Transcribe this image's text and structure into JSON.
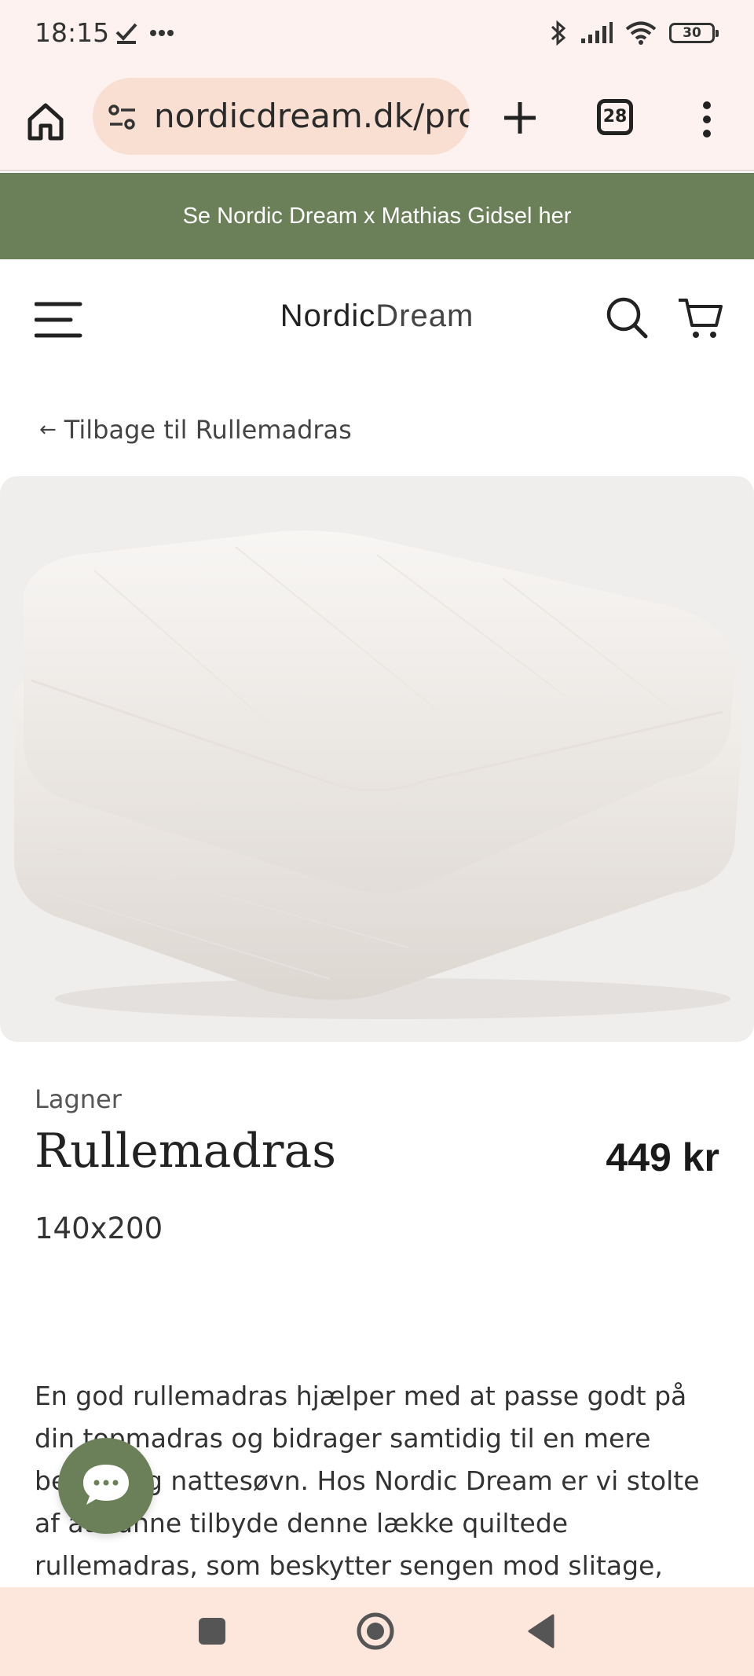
{
  "status_bar": {
    "time": "18:15",
    "battery": "30"
  },
  "browser": {
    "url": "nordicdream.dk/pro",
    "tab_count": "28"
  },
  "banner": {
    "text": "Se Nordic Dream x Mathias Gidsel her"
  },
  "site_header": {
    "logo_bold": "Nordic",
    "logo_light": "Dream"
  },
  "breadcrumb": {
    "arrow": "←",
    "label": "Tilbage til Rullemadras"
  },
  "product": {
    "category": "Lagner",
    "title": "Rullemadras",
    "price": "449 kr",
    "size": "140x200",
    "description": "En god rullemadras hjælper med at passe godt på din topmadras og bidrager samtidig til en mere behagelig nattesøvn. Hos Nordic Dream er vi stolte af at kunne tilbyde denne lække quiltede rullemadras, som beskytter sengen mod slitage, snavs og den fugt,"
  },
  "colors": {
    "banner_bg": "#6b8059",
    "chrome_bg": "#fdf2ef",
    "url_bg": "#f9dfd2",
    "chat_bg": "#6b8059"
  },
  "icons": {
    "home": "home-icon",
    "site_settings": "tune-icon",
    "new_tab": "plus-icon",
    "browser_menu": "more-vert-icon",
    "hamburger": "menu-icon",
    "search": "search-icon",
    "cart": "cart-icon",
    "chat": "chat-icon"
  }
}
